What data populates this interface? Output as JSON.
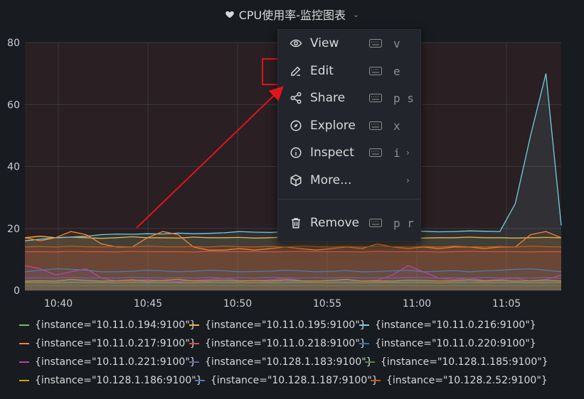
{
  "panel": {
    "title": "CPU使用率-监控图表"
  },
  "menu": {
    "items": [
      {
        "label": "View",
        "shortcut": "v",
        "icon": "eye-icon",
        "submenu": false
      },
      {
        "label": "Edit",
        "shortcut": "e",
        "icon": "edit-icon",
        "submenu": false
      },
      {
        "label": "Share",
        "shortcut": "p s",
        "icon": "share-icon",
        "submenu": false
      },
      {
        "label": "Explore",
        "shortcut": "x",
        "icon": "compass-icon",
        "submenu": false
      },
      {
        "label": "Inspect",
        "shortcut": "i",
        "icon": "info-icon",
        "submenu": true
      },
      {
        "label": "More...",
        "shortcut": "",
        "icon": "cube-icon",
        "submenu": true
      },
      {
        "label": "Remove",
        "shortcut": "p r",
        "icon": "trash-icon",
        "submenu": false
      }
    ]
  },
  "colors": {
    "highlight": "#e0151b",
    "background": "#181b1f"
  },
  "chart_data": {
    "type": "line",
    "ylim": [
      0,
      80
    ],
    "yticks": [
      "0",
      "20",
      "40",
      "60",
      "80"
    ],
    "xticks": [
      "10:40",
      "10:45",
      "10:50",
      "10:55",
      "11:00",
      "11:05"
    ],
    "x": [
      0,
      1,
      2,
      3,
      4,
      5,
      6,
      7,
      8,
      9,
      10,
      11,
      12,
      13,
      14,
      15,
      16,
      17,
      18,
      19,
      20,
      21,
      22,
      23,
      24,
      25,
      26,
      27,
      28,
      29,
      30,
      31,
      32,
      33,
      34,
      35
    ],
    "series": [
      {
        "name": "{instance=\"10.11.0.194:9100\"}",
        "color": "#73bf69",
        "values": [
          2.5,
          2.5,
          2.4,
          2.6,
          2.5,
          2.5,
          2.4,
          2.6,
          2.5,
          2.5,
          2.5,
          2.4,
          2.6,
          2.5,
          2.5,
          2.5,
          2.4,
          2.5,
          2.6,
          2.5,
          2.5,
          2.5,
          2.4,
          2.6,
          2.5,
          2.5,
          2.5,
          2.4,
          2.5,
          2.6,
          2.5,
          2.5,
          2.5,
          2.4,
          2.5,
          2.5
        ]
      },
      {
        "name": "{instance=\"10.11.0.195:9100\"}",
        "color": "#eab839",
        "values": [
          17,
          17.5,
          17,
          17.2,
          17,
          16.8,
          17,
          17.3,
          17,
          17,
          16.9,
          17.2,
          17,
          17,
          17.1,
          16.9,
          17,
          17.2,
          17,
          17,
          16.8,
          17,
          17.2,
          17,
          17,
          17.1,
          16.9,
          17,
          17,
          17.2,
          17,
          17,
          16.9,
          17,
          17.1,
          17
        ]
      },
      {
        "name": "{instance=\"10.11.0.216:9100\"}",
        "color": "#6ed0e0",
        "values": [
          16,
          16.5,
          17,
          17.2,
          17.5,
          18,
          18.2,
          18.1,
          18.3,
          18.2,
          18.5,
          18.3,
          18.4,
          18.6,
          19,
          18.8,
          18.7,
          18.9,
          19,
          19.1,
          19,
          19.2,
          19,
          19.1,
          19,
          19.2,
          19.1,
          18.9,
          19,
          19.2,
          19.1,
          19,
          28,
          50,
          70,
          21
        ]
      },
      {
        "name": "{instance=\"10.11.0.217:9100\"}",
        "color": "#ef843c",
        "values": [
          17,
          16,
          17,
          19,
          18,
          15,
          14,
          14,
          17,
          19,
          18,
          14,
          13,
          13,
          13.5,
          13,
          13.5,
          14,
          13.5,
          13,
          13.5,
          14,
          13.5,
          15,
          14,
          13.5,
          14,
          13.5,
          14,
          14,
          13.5,
          14,
          14,
          18,
          19,
          17
        ]
      },
      {
        "name": "{instance=\"10.11.0.218:9100\"}",
        "color": "#e24d42",
        "values": [
          12.5,
          12.5,
          12.4,
          12.6,
          12.5,
          12.5,
          12.4,
          12.6,
          12.5,
          12.5,
          12.5,
          12.4,
          12.6,
          12.5,
          12.5,
          12.5,
          12.4,
          12.5,
          12.6,
          12.5,
          12.5,
          12.5,
          12.4,
          12.6,
          12.5,
          12.5,
          12.5,
          12.4,
          12.5,
          12.6,
          12.5,
          12.5,
          12.5,
          12.4,
          12.5,
          12.5
        ]
      },
      {
        "name": "{instance=\"10.11.0.220:9100\"}",
        "color": "#1f78c1",
        "values": [
          2.8,
          2.9,
          2.8,
          3,
          2.9,
          2.8,
          2.9,
          3,
          2.8,
          2.9,
          2.8,
          3,
          2.9,
          2.8,
          2.9,
          3,
          2.8,
          2.9,
          2.8,
          3,
          2.9,
          2.8,
          2.9,
          3,
          2.8,
          2.9,
          2.8,
          3,
          2.9,
          2.8,
          2.9,
          3,
          2.8,
          2.9,
          2.8,
          3
        ]
      },
      {
        "name": "{instance=\"10.11.0.221:9100\"}",
        "color": "#ba43a9",
        "values": [
          8,
          7,
          5,
          6,
          7,
          4,
          3,
          3,
          3.5,
          3,
          3,
          3.2,
          3.5,
          4,
          3.2,
          3,
          3.4,
          4,
          3.1,
          3,
          3.2,
          3.4,
          3,
          3.3,
          5,
          8,
          6,
          4,
          3.5,
          4,
          3.2,
          3.5,
          4,
          3,
          3.5,
          5
        ]
      },
      {
        "name": "{instance=\"10.128.1.183:9100\"}",
        "color": "#705da0",
        "values": [
          4,
          4.1,
          4,
          4.2,
          4,
          4.1,
          4,
          4.2,
          4.1,
          4,
          4.1,
          4,
          4.2,
          4,
          4.1,
          4,
          4.2,
          4.1,
          4,
          4.1,
          4,
          4.2,
          4,
          4.1,
          4,
          4.2,
          4.1,
          4,
          4.1,
          4,
          4.2,
          4,
          4.1,
          4,
          4.2,
          4
        ]
      },
      {
        "name": "{instance=\"10.128.1.185:9100\"}",
        "color": "#508642",
        "values": [
          1.5,
          1.6,
          1.5,
          1.7,
          1.5,
          1.6,
          1.5,
          1.7,
          1.6,
          1.5,
          1.6,
          1.5,
          1.7,
          1.5,
          1.6,
          1.5,
          1.7,
          1.6,
          1.5,
          1.6,
          1.5,
          1.7,
          1.5,
          1.6,
          1.5,
          1.7,
          1.6,
          1.5,
          1.6,
          1.5,
          1.7,
          1.5,
          1.6,
          1.5,
          1.7,
          1.5
        ]
      },
      {
        "name": "{instance=\"10.128.1.186:9100\"}",
        "color": "#cca300",
        "values": [
          3,
          3.1,
          3,
          3.5,
          3.2,
          3,
          3.1,
          3.4,
          3,
          3.2,
          3.6,
          3,
          3.1,
          3.3,
          3,
          3.2,
          3,
          3.4,
          3.1,
          3,
          3.2,
          3.5,
          3,
          3.1,
          3,
          3.3,
          3.2,
          3,
          3.1,
          3.4,
          3,
          3.2,
          3,
          3.1,
          3.3,
          3
        ]
      },
      {
        "name": "{instance=\"10.128.1.187:9100\"}",
        "color": "#447ebc",
        "values": [
          6,
          6.5,
          7,
          6.8,
          6.5,
          6,
          6,
          6.2,
          6.5,
          6.3,
          6,
          6.2,
          6.5,
          6.3,
          6,
          6.1,
          6.2,
          6.5,
          6.3,
          6,
          6.2,
          6.4,
          6,
          6.1,
          6.3,
          6.5,
          6,
          6.2,
          6.4,
          6,
          6.3,
          6.5,
          6.8,
          7,
          6.5,
          6
        ]
      },
      {
        "name": "{instance=\"10.128.2.52:9100\"}",
        "color": "#c15c17",
        "values": [
          14,
          14.2,
          14,
          14.3,
          14.1,
          14,
          14.2,
          14,
          14.3,
          14.1,
          14,
          14.2,
          14,
          14.3,
          14.1,
          14,
          14.2,
          14,
          14.3,
          14.1,
          14,
          14.2,
          14,
          14.3,
          14.1,
          14,
          14.2,
          14,
          14.3,
          14.1,
          14,
          14.2,
          14,
          14.3,
          14.1,
          14
        ]
      }
    ]
  }
}
